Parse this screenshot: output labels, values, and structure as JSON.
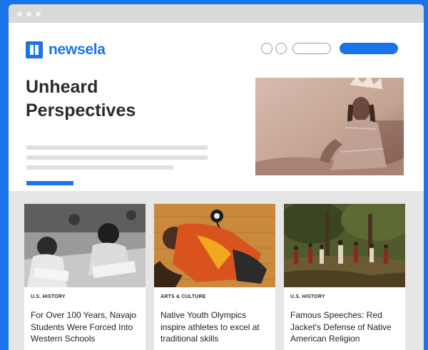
{
  "brand": {
    "name": "newsela",
    "color": "#1a73e8"
  },
  "hero": {
    "title": "Unheard Perspectives"
  },
  "cards": [
    {
      "category": "U.S. HISTORY",
      "title": "For Over 100 Years, Navajo Students Were Forced Into Western Schools"
    },
    {
      "category": "ARTS & CULTURE",
      "title": "Native Youth Olympics inspire athletes to excel at traditional skills"
    },
    {
      "category": "U.S. HISTORY",
      "title": "Famous Speeches: Red Jacket's Defense of Native American Religion"
    }
  ],
  "icons": {
    "logo": "newsela-book-icon"
  }
}
